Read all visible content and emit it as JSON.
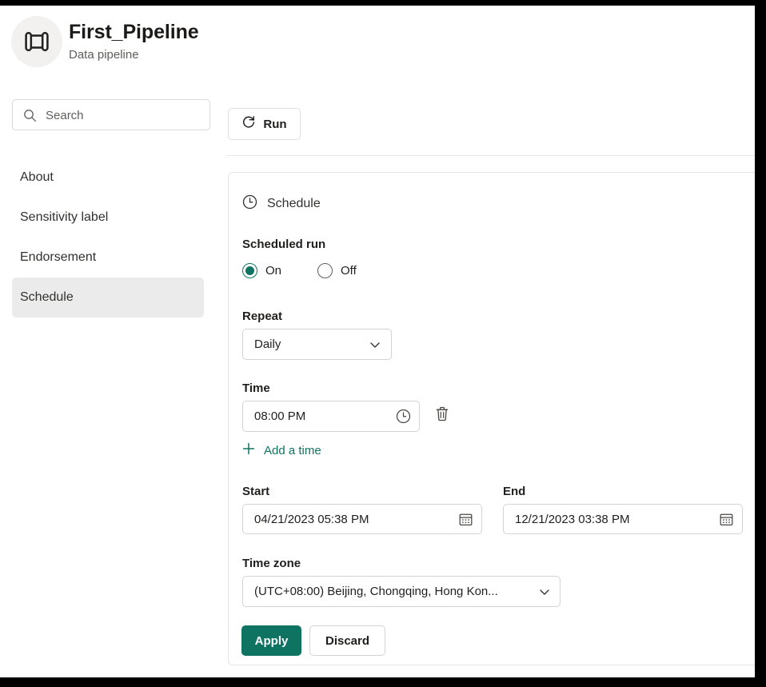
{
  "header": {
    "title": "First_Pipeline",
    "subtitle": "Data pipeline",
    "icon": "data-pipeline-icon"
  },
  "search": {
    "placeholder": "Search",
    "value": "",
    "icon": "search-icon"
  },
  "toolbar": {
    "run_label": "Run",
    "run_icon": "refresh-arrow-icon"
  },
  "sidebar": {
    "items": [
      {
        "label": "About",
        "selected": false
      },
      {
        "label": "Sensitivity label",
        "selected": false
      },
      {
        "label": "Endorsement",
        "selected": false
      },
      {
        "label": "Schedule",
        "selected": true
      }
    ]
  },
  "panel": {
    "heading": "Schedule",
    "heading_icon": "clock-icon",
    "scheduled_run": {
      "label": "Scheduled run",
      "options": [
        {
          "label": "On",
          "checked": true
        },
        {
          "label": "Off",
          "checked": false
        }
      ]
    },
    "repeat": {
      "label": "Repeat",
      "value": "Daily",
      "icon": "chevron-down-icon"
    },
    "time": {
      "label": "Time",
      "value": "08:00 PM",
      "icon": "clock-icon",
      "delete_icon": "trash-icon",
      "add_label": "Add a time",
      "add_icon": "plus-icon"
    },
    "start": {
      "label": "Start",
      "value": "04/21/2023 05:38 PM",
      "icon": "calendar-icon"
    },
    "end": {
      "label": "End",
      "value": "12/21/2023 03:38 PM",
      "icon": "calendar-icon"
    },
    "timezone": {
      "label": "Time zone",
      "value": "(UTC+08:00) Beijing, Chongqing, Hong Kon...",
      "icon": "chevron-down-icon"
    },
    "actions": {
      "apply_label": "Apply",
      "discard_label": "Discard"
    }
  },
  "colors": {
    "accent_green": "#0f7362",
    "selected_nav_bg": "#ebebeb",
    "border": "#d6d4d2",
    "text_primary": "#201f1e",
    "text_secondary": "#605e5c"
  }
}
